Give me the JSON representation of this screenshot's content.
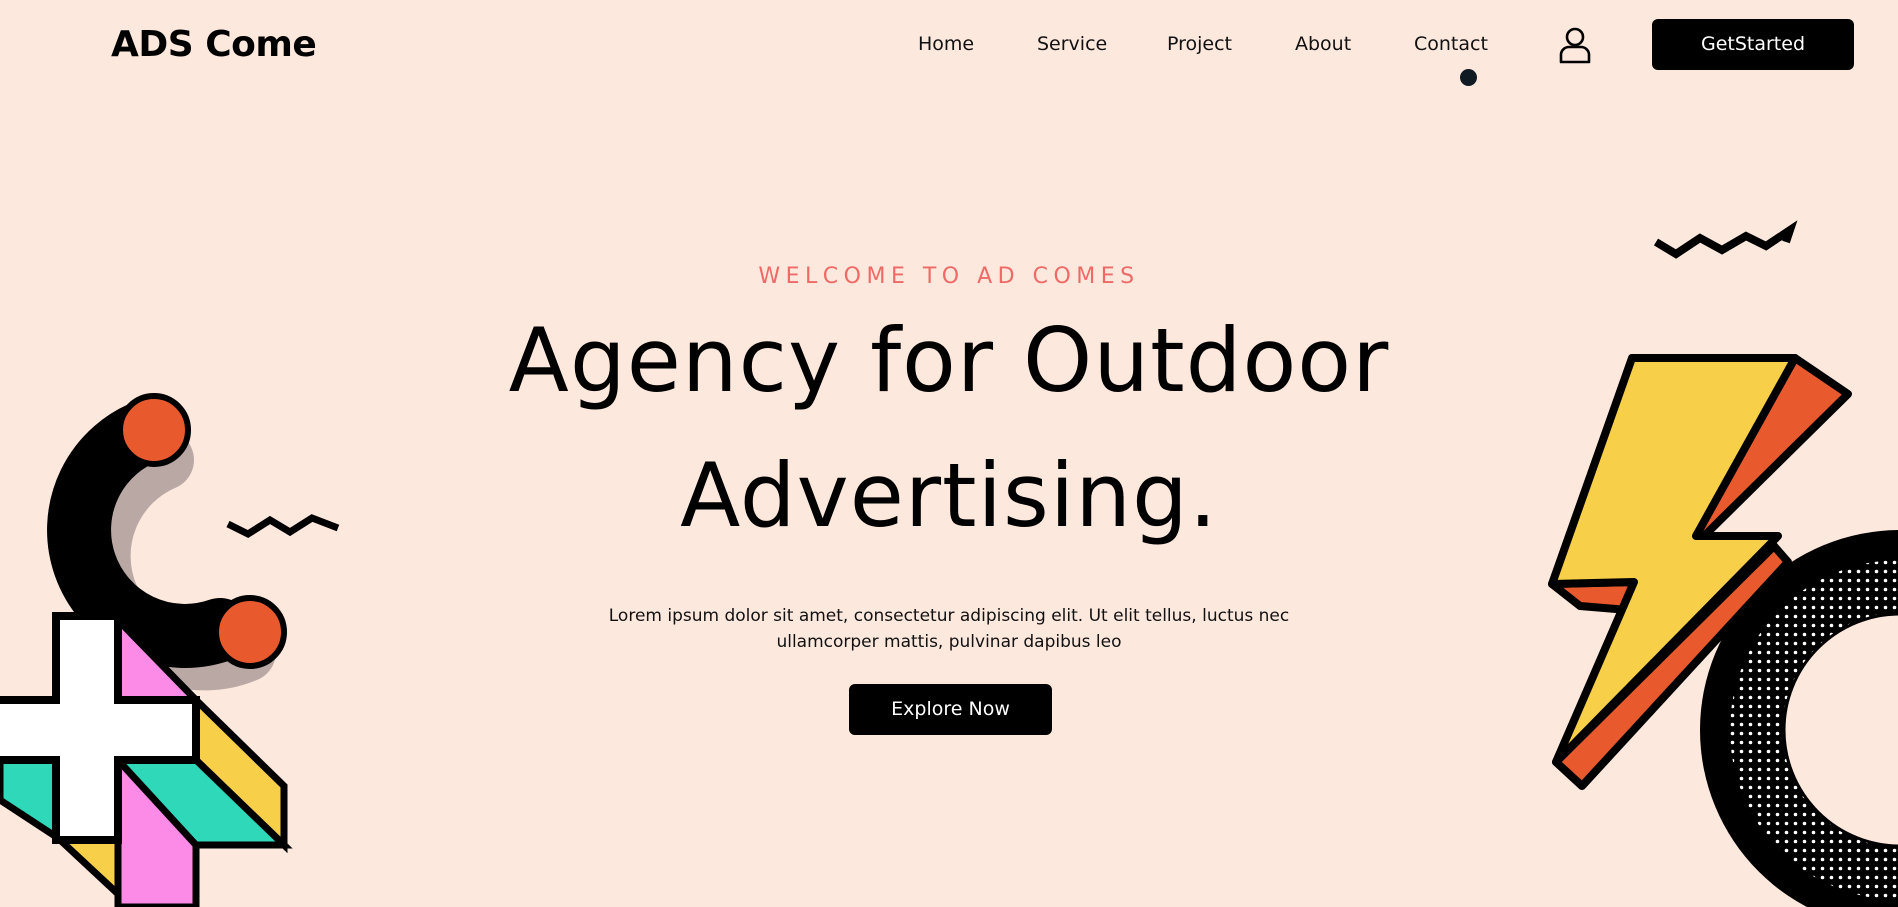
{
  "header": {
    "logo": "ADS Come",
    "nav": [
      {
        "label": "Home"
      },
      {
        "label": "Service"
      },
      {
        "label": "Project"
      },
      {
        "label": "About"
      },
      {
        "label": "Contact"
      }
    ],
    "user_icon": "user-icon",
    "cta_label": "GetStarted"
  },
  "hero": {
    "eyebrow": "WELCOME TO AD COMES",
    "headline_line1": "Agency for Outdoor",
    "headline_line2": "Advertising.",
    "description_line1": "Lorem ipsum dolor sit amet, consectetur adipiscing elit. Ut elit tellus, luctus nec",
    "description_line2": "ullamcorper mattis, pulvinar dapibus leo",
    "button_label": "Explore Now"
  },
  "colors": {
    "background": "#fde8de",
    "accent": "#ef6a67",
    "primary": "#000000",
    "orange": "#e85a2e",
    "yellow": "#f7cf48",
    "teal": "#2ed8b9",
    "pink": "#fc8be8"
  }
}
